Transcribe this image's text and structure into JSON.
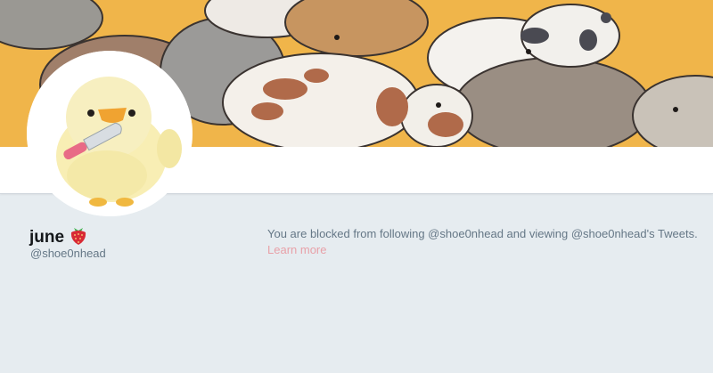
{
  "profile": {
    "name": "june",
    "name_emoji": "strawberry-icon",
    "handle": "@shoe0nhead"
  },
  "notice": {
    "blocked_text": "You are blocked from following @shoe0nhead and viewing @shoe0nhead's Tweets.",
    "learn_more_label": "Learn more"
  },
  "colors": {
    "banner_bg": "#f0b54a",
    "page_bg": "#e6ecf0",
    "link": "#e8a1a8",
    "muted_text": "#657786"
  }
}
